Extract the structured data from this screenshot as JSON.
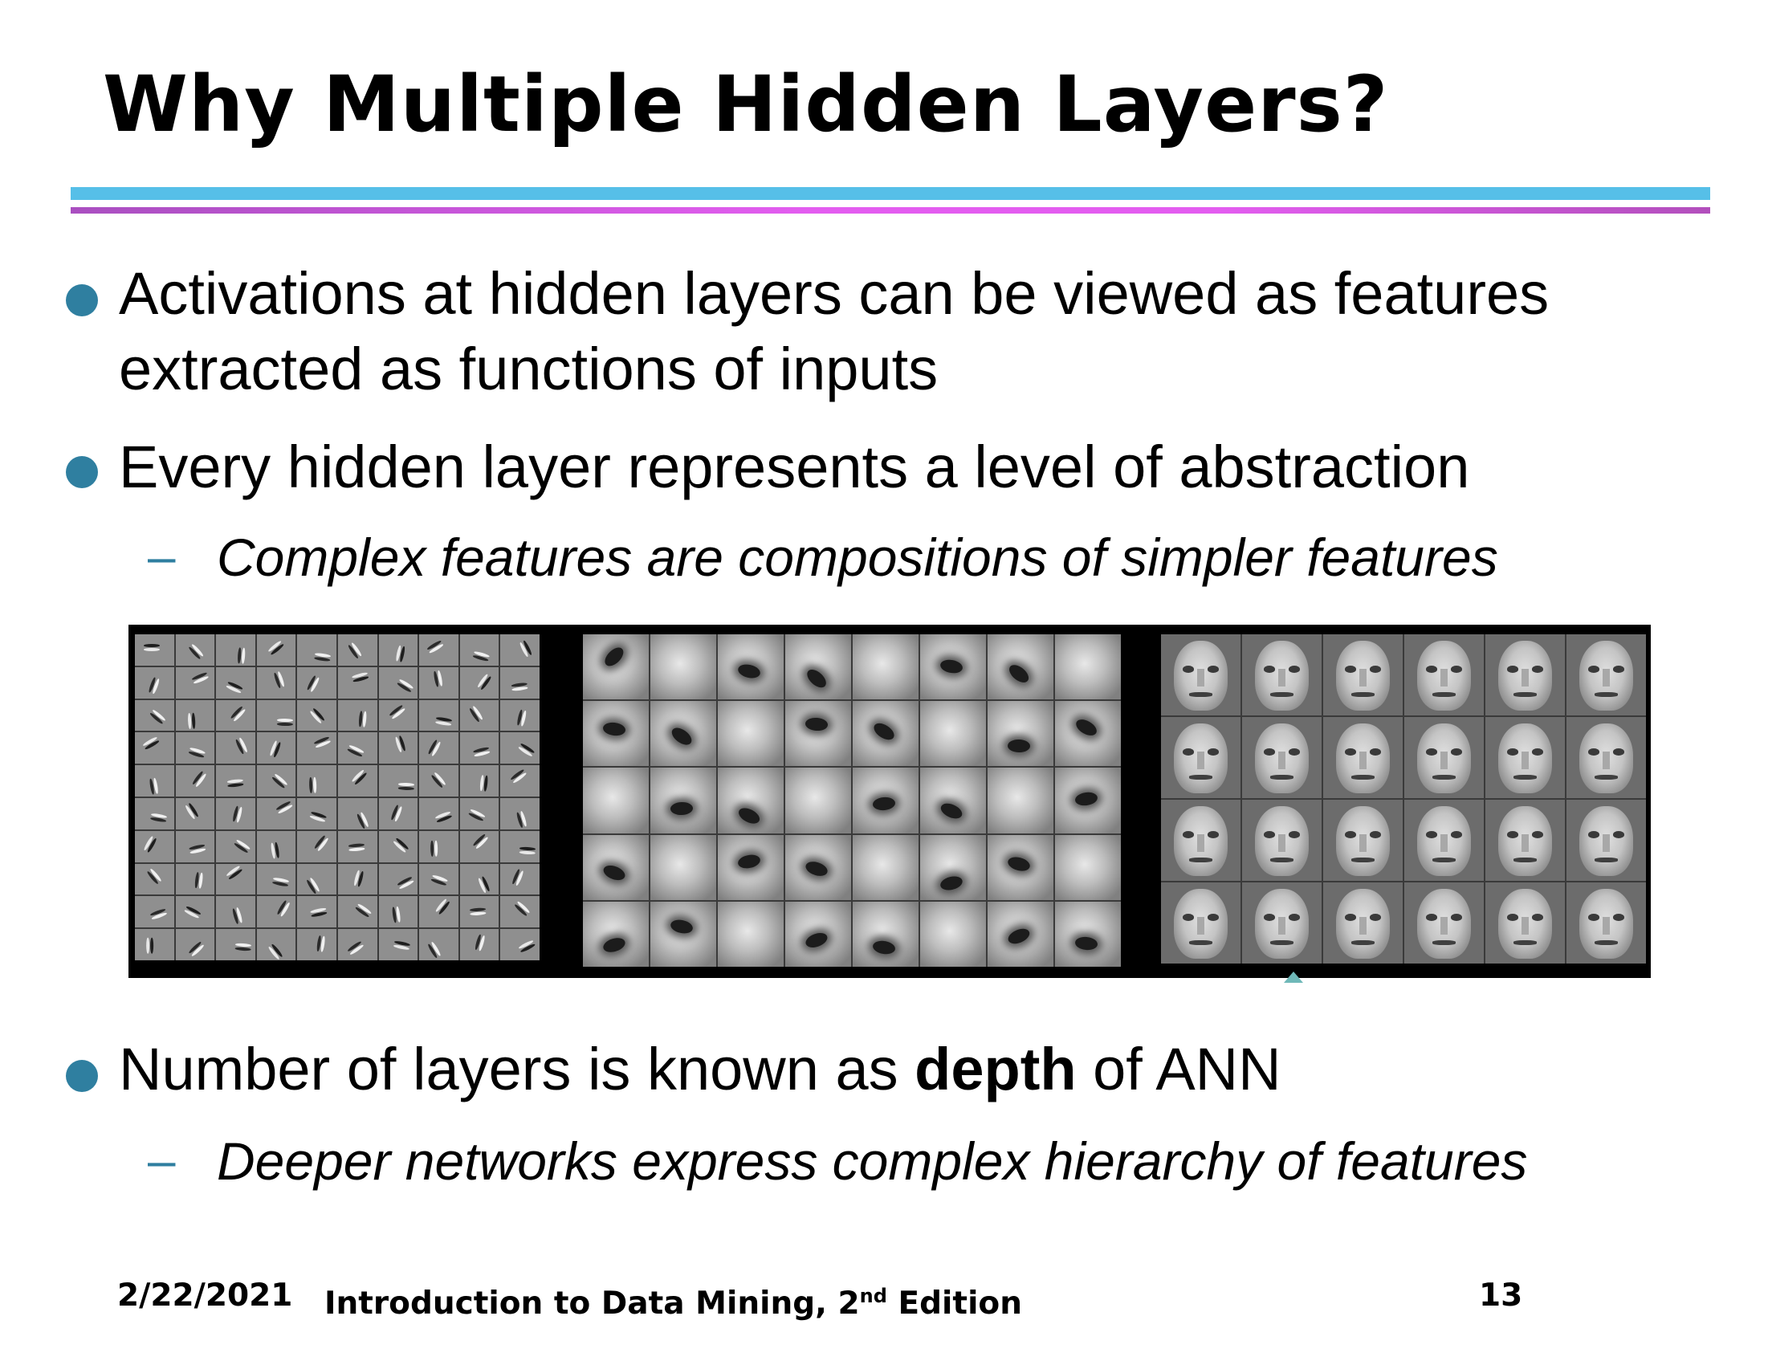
{
  "slide": {
    "title": "Why Multiple Hidden Layers?",
    "bullets": [
      {
        "line1": "Activations at hidden layers can be viewed as features",
        "line2": "extracted as functions of inputs"
      },
      {
        "text": "Every hidden layer represents a level of abstraction",
        "sub": "Complex features are compositions of simpler features"
      },
      {
        "pre": "Number of layers is known as ",
        "bold": "depth",
        "post": " of ANN",
        "sub": "Deeper networks express complex hierarchy of features"
      }
    ],
    "sub_dash": "–",
    "colors": {
      "bullet": "#2f7fa0",
      "rule_top": "#56bfe8",
      "rule_bottom": "#e35df0"
    }
  },
  "footer": {
    "date": "2/22/2021",
    "book_pre": "Introduction to Data Mining, 2",
    "book_sup": "nd",
    "book_post": " Edition",
    "page": "13"
  }
}
